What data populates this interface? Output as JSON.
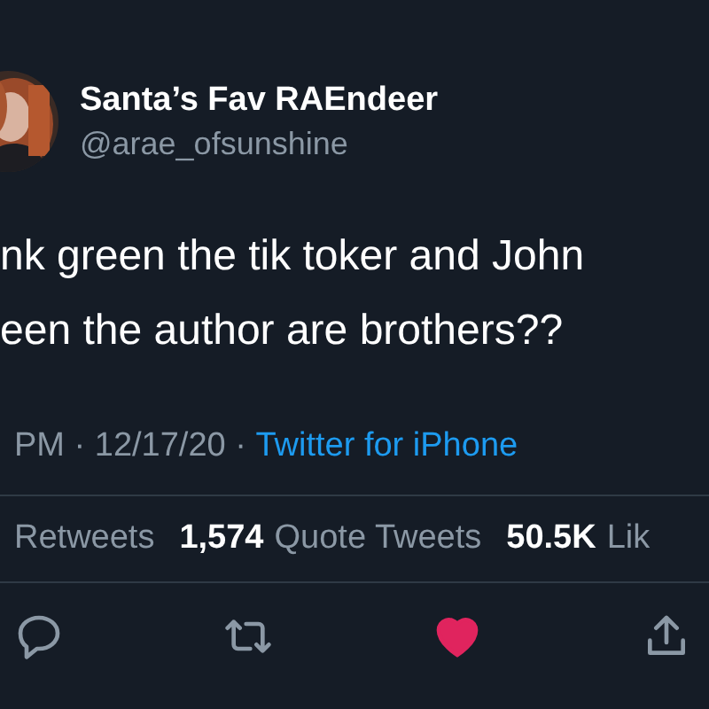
{
  "author": {
    "name": "Santa’s Fav RAEndeer",
    "handle": "@arae_ofsunshine"
  },
  "body_lines": [
    "nk green the tik toker and John",
    "een the author are brothers??"
  ],
  "meta": {
    "time_date": "PM · 12/17/20 · ",
    "source": "Twitter for iPhone"
  },
  "stats": [
    {
      "kind": "label",
      "text": "Retweets"
    },
    {
      "kind": "count",
      "text": "1,574"
    },
    {
      "kind": "label",
      "text": "Quote Tweets"
    },
    {
      "kind": "count",
      "text": "50.5K"
    },
    {
      "kind": "label",
      "text": "Lik"
    }
  ],
  "actions": [
    {
      "kind": "reply"
    },
    {
      "kind": "retweet"
    },
    {
      "kind": "like",
      "on": true
    },
    {
      "kind": "share"
    }
  ]
}
